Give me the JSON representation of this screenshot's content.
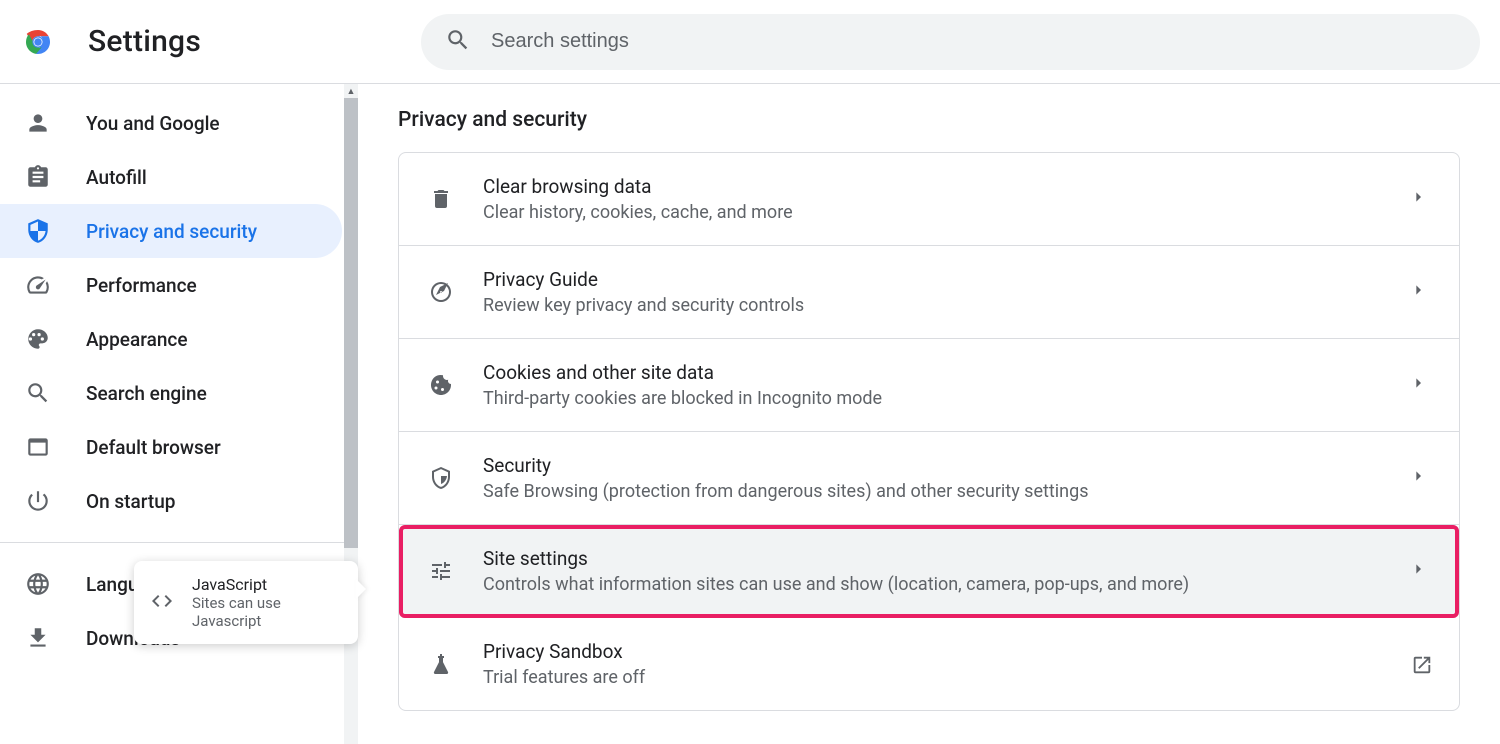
{
  "header": {
    "title": "Settings",
    "search_placeholder": "Search settings"
  },
  "sidebar": {
    "items": [
      {
        "label": "You and Google"
      },
      {
        "label": "Autofill"
      },
      {
        "label": "Privacy and security"
      },
      {
        "label": "Performance"
      },
      {
        "label": "Appearance"
      },
      {
        "label": "Search engine"
      },
      {
        "label": "Default browser"
      },
      {
        "label": "On startup"
      },
      {
        "label": "Languages"
      },
      {
        "label": "Downloads"
      }
    ]
  },
  "section": {
    "title": "Privacy and security"
  },
  "rows": [
    {
      "title": "Clear browsing data",
      "sub": "Clear history, cookies, cache, and more"
    },
    {
      "title": "Privacy Guide",
      "sub": "Review key privacy and security controls"
    },
    {
      "title": "Cookies and other site data",
      "sub": "Third-party cookies are blocked in Incognito mode"
    },
    {
      "title": "Security",
      "sub": "Safe Browsing (protection from dangerous sites) and other security settings"
    },
    {
      "title": "Site settings",
      "sub": "Controls what information sites can use and show (location, camera, pop-ups, and more)"
    },
    {
      "title": "Privacy Sandbox",
      "sub": "Trial features are off"
    }
  ],
  "tooltip": {
    "title": "JavaScript",
    "sub": "Sites can use Javascript"
  }
}
